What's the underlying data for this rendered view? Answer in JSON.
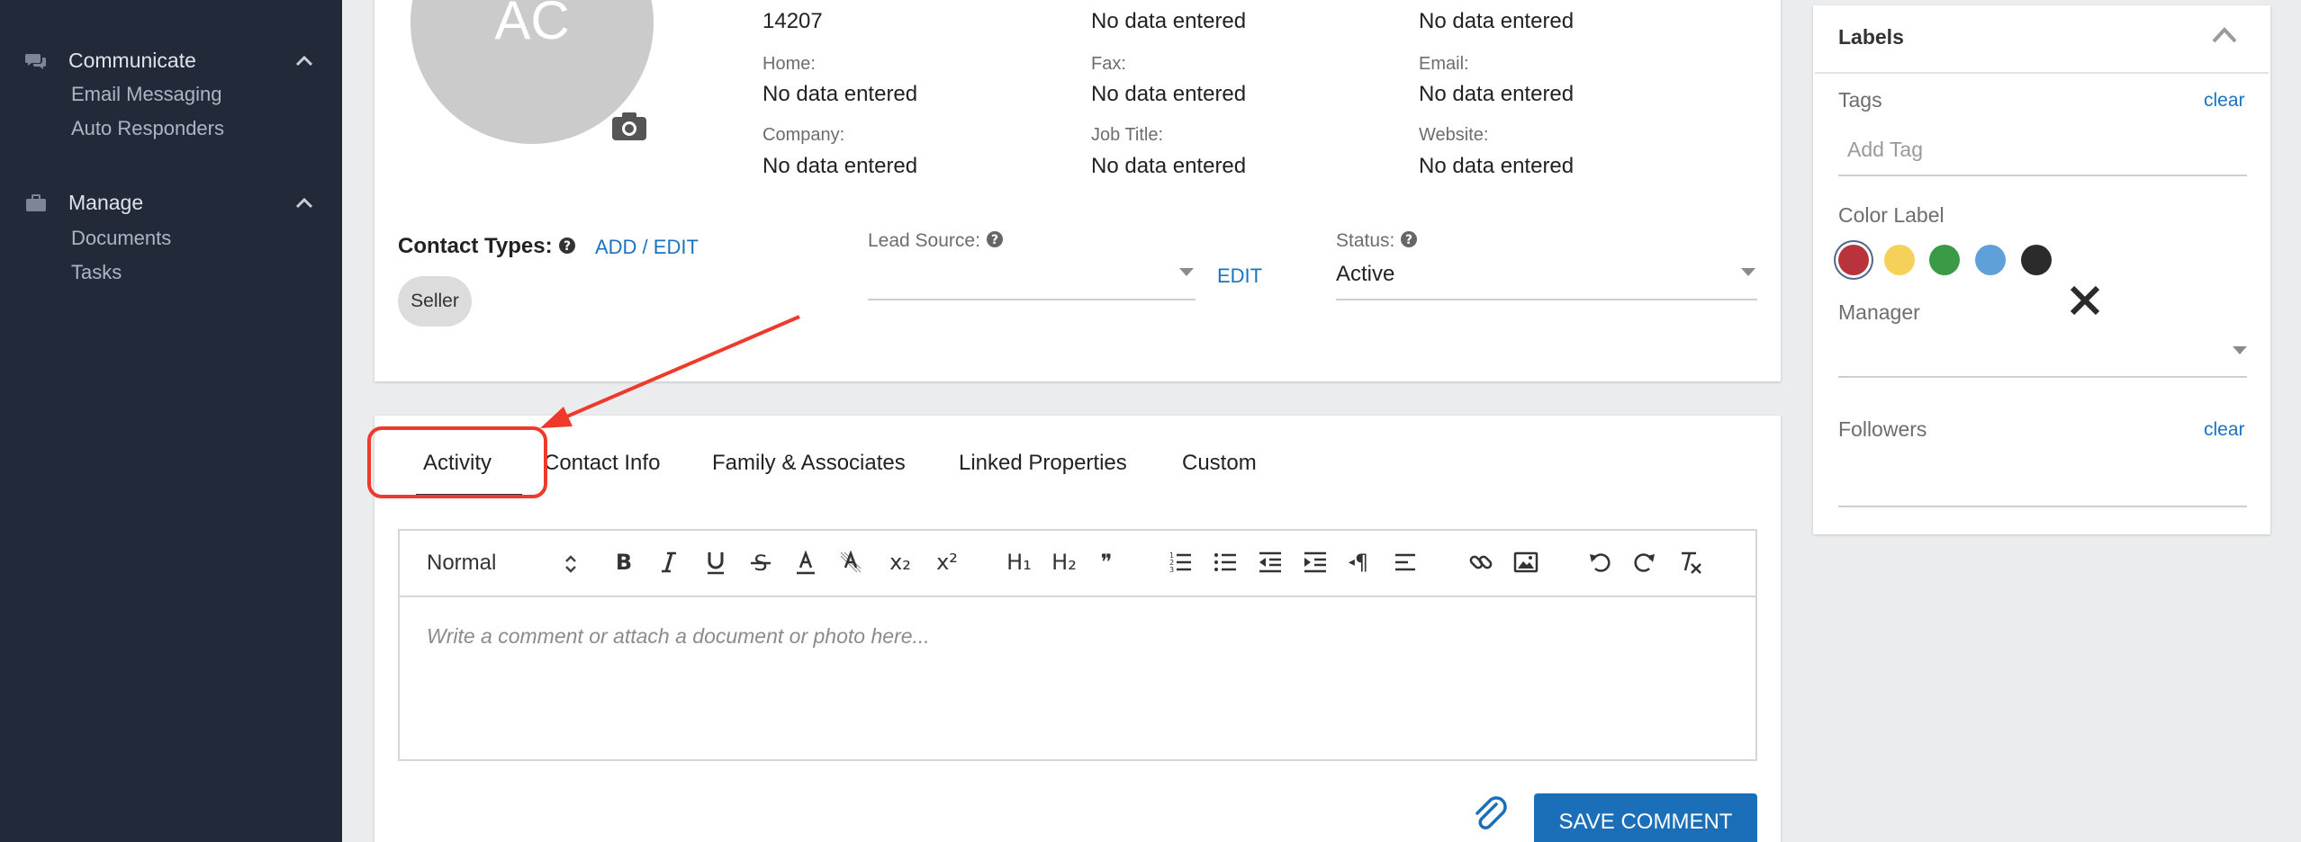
{
  "sidebar": {
    "groups": [
      {
        "label": "Communicate",
        "icon": "chat-bubbles-icon",
        "items": [
          "Email Messaging",
          "Auto Responders"
        ]
      },
      {
        "label": "Manage",
        "icon": "briefcase-icon",
        "items": [
          "Documents",
          "Tasks"
        ]
      }
    ]
  },
  "profile": {
    "avatar_initials": "AC",
    "fields": {
      "zip": {
        "value": "14207"
      },
      "top_mid": {
        "value": "No data entered"
      },
      "top_right": {
        "value": "No data entered"
      },
      "home": {
        "label": "Home:",
        "value": "No data entered"
      },
      "fax": {
        "label": "Fax:",
        "value": "No data entered"
      },
      "email": {
        "label": "Email:",
        "value": "No data entered"
      },
      "company": {
        "label": "Company:",
        "value": "No data entered"
      },
      "job_title": {
        "label": "Job Title:",
        "value": "No data entered"
      },
      "website": {
        "label": "Website:",
        "value": "No data entered"
      }
    },
    "contact_types": {
      "label": "Contact Types:",
      "action": "ADD / EDIT",
      "chips": [
        "Seller"
      ]
    },
    "lead_source": {
      "label": "Lead Source:",
      "value": "",
      "action": "EDIT"
    },
    "status": {
      "label": "Status:",
      "value": "Active"
    }
  },
  "tabs": [
    "Activity",
    "Contact Info",
    "Family & Associates",
    "Linked Properties",
    "Custom"
  ],
  "active_tab": "Activity",
  "editor": {
    "format_value": "Normal",
    "placeholder": "Write a comment or attach a document or photo here...",
    "toolbar": {
      "subscript": "x₂",
      "superscript": "x²",
      "h1": "H₁",
      "h2": "H₂",
      "blockquote": "❞",
      "rtl": "¶"
    },
    "save_label": "SAVE COMMENT"
  },
  "labels_panel": {
    "title": "Labels",
    "tags": {
      "label": "Tags",
      "clear": "clear",
      "placeholder": "Add Tag"
    },
    "color_label": {
      "label": "Color Label",
      "colors": [
        "#b8333b",
        "#f6d15a",
        "#3a9a45",
        "#5fa0d8",
        "#2b2b2b"
      ],
      "selected": 0
    },
    "manager": {
      "label": "Manager",
      "value": ""
    },
    "followers": {
      "label": "Followers",
      "clear": "clear"
    }
  },
  "accent_color": "#1a6fb8",
  "annotation_color": "#ee3a2b"
}
